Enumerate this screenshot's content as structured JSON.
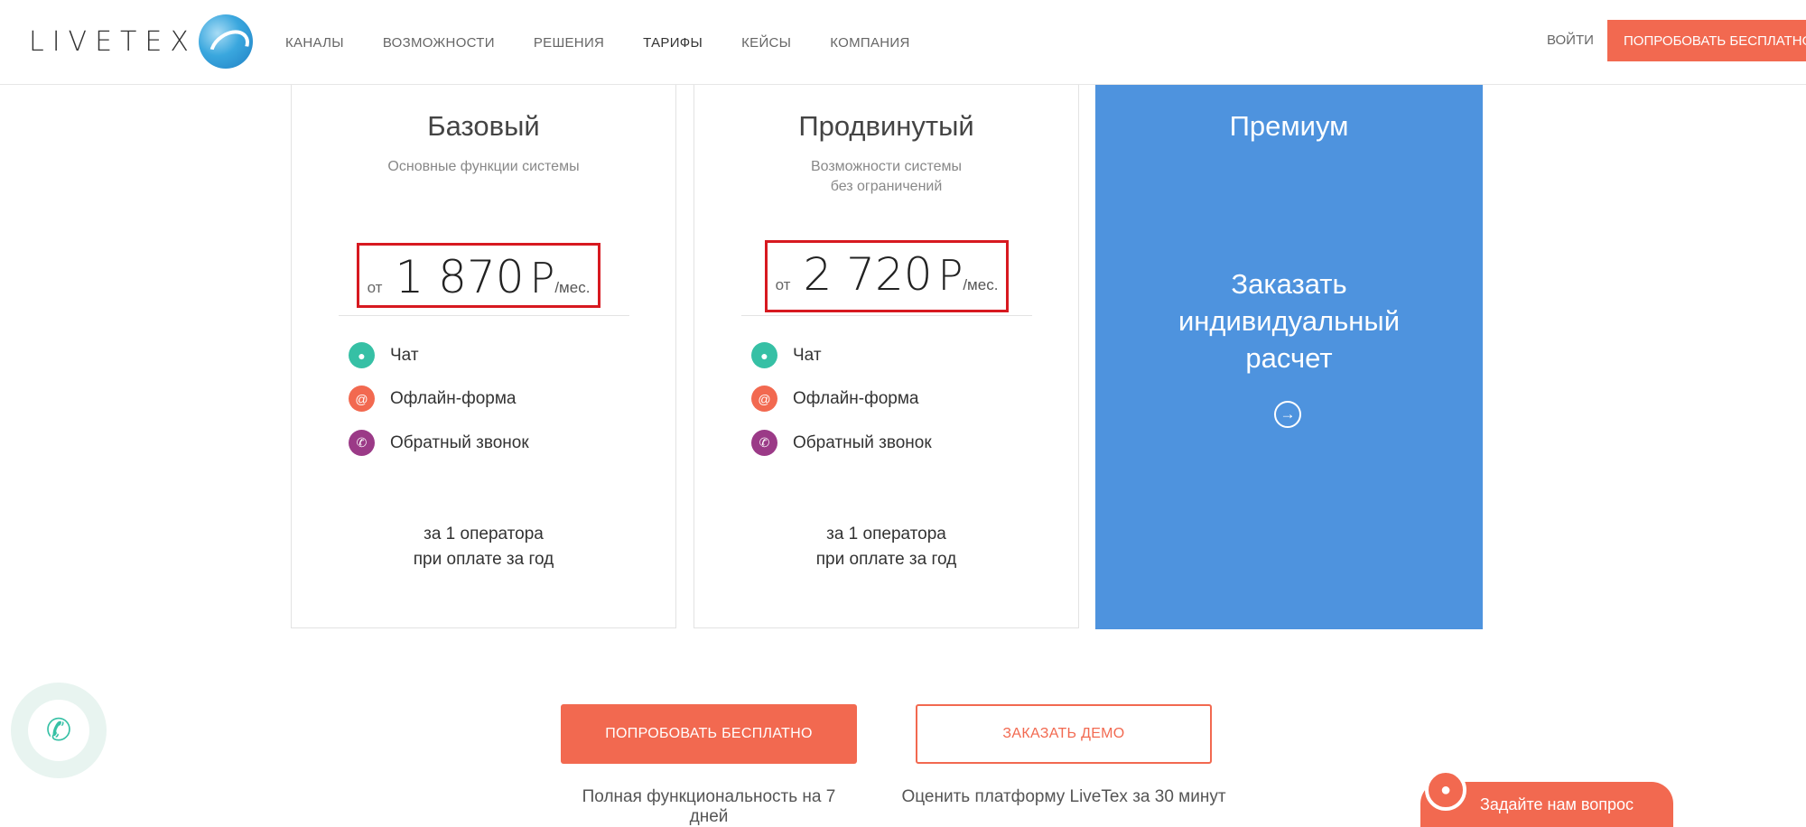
{
  "header": {
    "logo_text": "LIVETEX",
    "nav": [
      "КАНАЛЫ",
      "ВОЗМОЖНОСТИ",
      "РЕШЕНИЯ",
      "ТАРИФЫ",
      "КЕЙСЫ",
      "КОМПАНИЯ"
    ],
    "active_nav": "ТАРИФЫ",
    "login": "ВОЙТИ",
    "try_free": "ПОПРОБОВАТЬ БЕСПЛАТНО"
  },
  "plans": [
    {
      "title": "Базовый",
      "subtitle": "Основные функции системы",
      "price_from": "от",
      "price": "1 870",
      "currency": "Р",
      "period": "/мес.",
      "features": [
        "Чат",
        "Офлайн-форма",
        "Обратный звонок"
      ],
      "operator_line1": "за 1 оператора",
      "operator_line2": "при оплате за год"
    },
    {
      "title": "Продвинутый",
      "subtitle_line1": "Возможности системы",
      "subtitle_line2": "без ограничений",
      "price_from": "от",
      "price": "2 720",
      "currency": "Р",
      "period": "/мес.",
      "features": [
        "Чат",
        "Офлайн-форма",
        "Обратный звонок"
      ],
      "operator_line1": "за 1 оператора",
      "operator_line2": "при оплате за год"
    }
  ],
  "premium": {
    "title": "Премиум",
    "order_line1": "Заказать",
    "order_line2": "индивидуальный",
    "order_line3": "расчет",
    "arrow_icon": "arrow-right-circle-icon"
  },
  "cta": {
    "try_free": "ПОПРОБОВАТЬ БЕСПЛАТНО",
    "try_caption": "Полная функциональность на 7 дней",
    "demo": "ЗАКАЗАТЬ ДЕМО",
    "demo_caption": "Оценить платформу LiveTex за 30 минут"
  },
  "widgets": {
    "ask": "Задайте нам вопрос",
    "call_icon": "phone-icon"
  },
  "colors": {
    "accent": "#f26950",
    "premium_bg": "#4e93de",
    "highlight_border": "#d71920",
    "chat_icon": "#36c0a5",
    "form_icon": "#f26950",
    "callback_icon": "#9b3a87"
  }
}
